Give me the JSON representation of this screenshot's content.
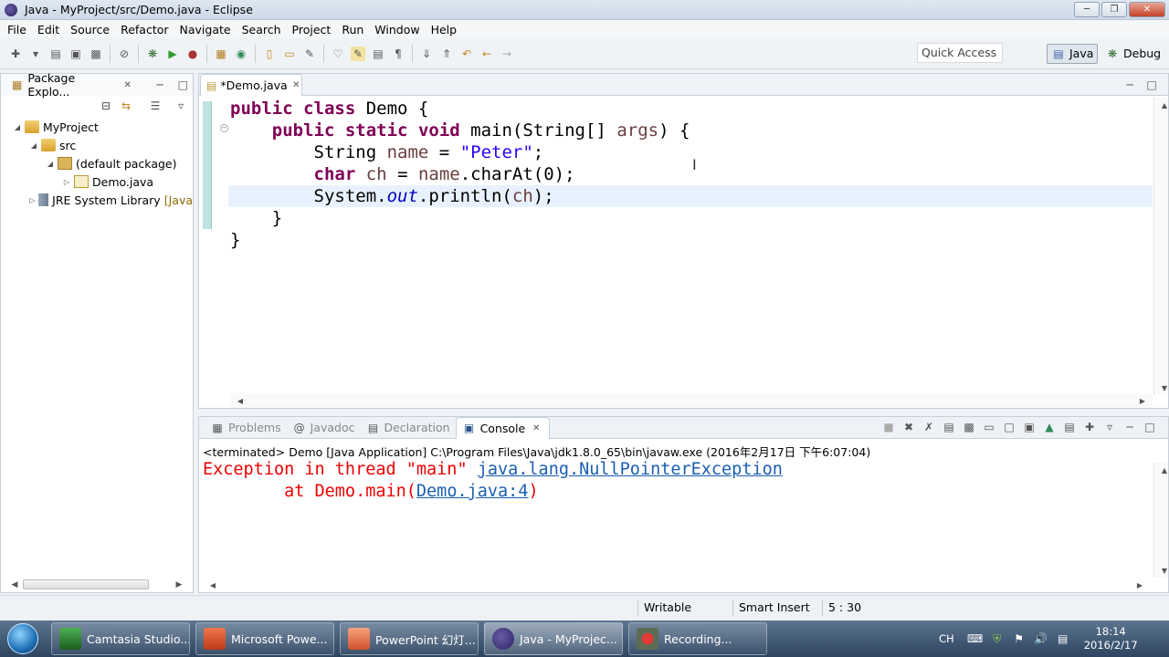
{
  "window": {
    "title": "Java - MyProject/src/Demo.java - Eclipse"
  },
  "menu": [
    "File",
    "Edit",
    "Source",
    "Refactor",
    "Navigate",
    "Search",
    "Project",
    "Run",
    "Window",
    "Help"
  ],
  "toolbar": {
    "quick_access": "Quick Access",
    "perspective_java": "Java",
    "perspective_debug": "Debug"
  },
  "package_explorer": {
    "tab_label": "Package Explo...",
    "project": "MyProject",
    "src": "src",
    "package": "(default package)",
    "file": "Demo.java",
    "jre": "JRE System Library",
    "jre_suffix": "[Java"
  },
  "editor": {
    "tab_label": "*Demo.java",
    "lines": [
      [
        {
          "t": "public",
          "c": "kw"
        },
        {
          "t": " "
        },
        {
          "t": "class",
          "c": "kw"
        },
        {
          "t": " Demo {"
        }
      ],
      [
        {
          "t": "    "
        },
        {
          "t": "public",
          "c": "kw"
        },
        {
          "t": " "
        },
        {
          "t": "static",
          "c": "kw"
        },
        {
          "t": " "
        },
        {
          "t": "void",
          "c": "kw"
        },
        {
          "t": " main(String[] "
        },
        {
          "t": "args",
          "c": "var"
        },
        {
          "t": ") {"
        }
      ],
      [
        {
          "t": "        String "
        },
        {
          "t": "name",
          "c": "var"
        },
        {
          "t": " = "
        },
        {
          "t": "\"Peter\"",
          "c": "str"
        },
        {
          "t": ";"
        }
      ],
      [
        {
          "t": "        "
        },
        {
          "t": "char",
          "c": "kw"
        },
        {
          "t": " "
        },
        {
          "t": "ch",
          "c": "var"
        },
        {
          "t": " = "
        },
        {
          "t": "name",
          "c": "var"
        },
        {
          "t": ".charAt(0);"
        }
      ],
      [
        {
          "t": "        System."
        },
        {
          "t": "out",
          "c": "st"
        },
        {
          "t": ".println("
        },
        {
          "t": "ch",
          "c": "var"
        },
        {
          "t": ");"
        }
      ],
      [
        {
          "t": "    }"
        }
      ],
      [
        {
          "t": "}"
        }
      ]
    ]
  },
  "console": {
    "tabs": [
      "Problems",
      "Javadoc",
      "Declaration",
      "Console"
    ],
    "terminated": "<terminated> Demo [Java Application] C:\\Program Files\\Java\\jdk1.8.0_65\\bin\\javaw.exe (2016年2月17日 下午6:07:04)",
    "line1_prefix": "Exception in thread \"main\" ",
    "line1_link": "java.lang.NullPointerException",
    "line2_prefix": "        at Demo.main(",
    "line2_link": "Demo.java:4",
    "line2_suffix": ")"
  },
  "status": {
    "writable": "Writable",
    "insert_mode": "Smart Insert",
    "position": "5 : 30"
  },
  "taskbar": {
    "items": [
      "Camtasia Studio...",
      "Microsoft Powe...",
      "PowerPoint 幻灯...",
      "Java - MyProjec...",
      "Recording..."
    ],
    "lang": "CH",
    "time": "18:14",
    "date": "2016/2/17"
  },
  "colors": {
    "keyword": "#7f0055",
    "string": "#2a00ff",
    "error": "#e00000",
    "link": "#1a5fb4"
  }
}
